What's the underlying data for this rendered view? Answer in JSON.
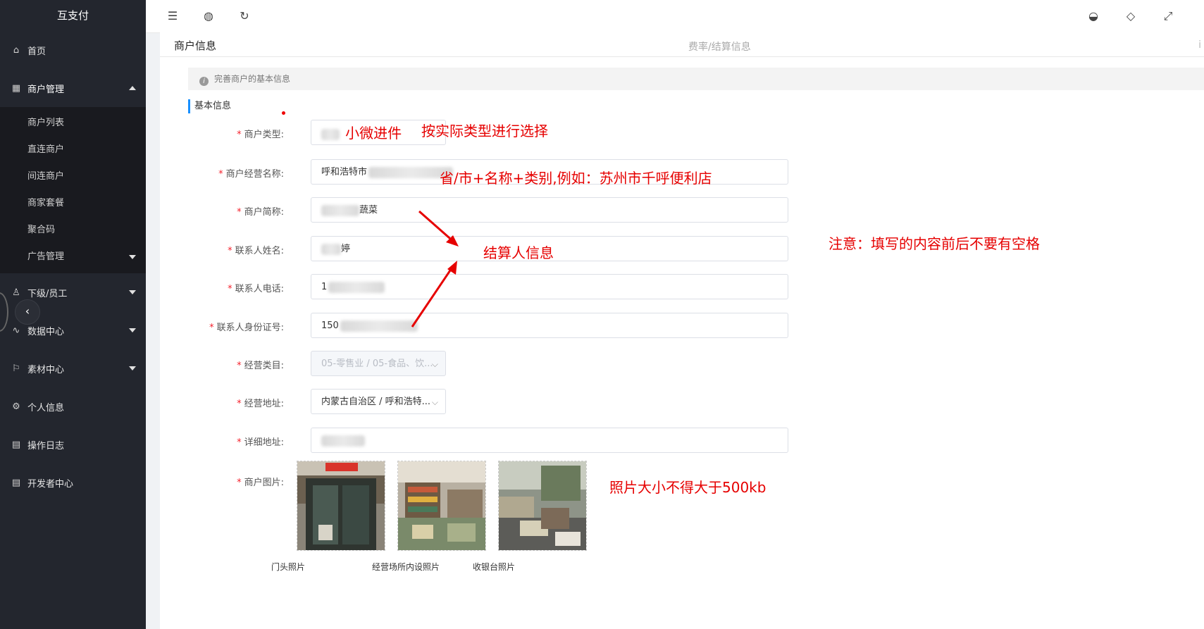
{
  "app": {
    "title": "互支付"
  },
  "sidebar": {
    "items": [
      {
        "label": "首页",
        "icon": "home-icon"
      },
      {
        "label": "商户管理",
        "icon": "grid-icon"
      },
      {
        "label": "下级/员工",
        "icon": "user-icon"
      },
      {
        "label": "数据中心",
        "icon": "pulse-icon"
      },
      {
        "label": "素材中心",
        "icon": "flag-icon"
      },
      {
        "label": "个人信息",
        "icon": "gear-icon"
      },
      {
        "label": "操作日志",
        "icon": "document-icon"
      },
      {
        "label": "开发者中心",
        "icon": "document-icon"
      }
    ],
    "submenu": [
      "商户列表",
      "直连商户",
      "间连商户",
      "商家套餐",
      "聚合码",
      "广告管理"
    ]
  },
  "panel": {
    "title": "商户信息",
    "tab_rate": "费率/结算信息",
    "tab_more": "i",
    "info": "完善商户的基本信息",
    "section": "基本信息"
  },
  "form": {
    "merchant_type": {
      "label": "商户类型:",
      "value": "小微进件"
    },
    "business_name": {
      "label": "商户经营名称:",
      "value": "呼和浩特市"
    },
    "short_name": {
      "label": "商户简称:",
      "value": "蔬菜"
    },
    "contact_name": {
      "label": "联系人姓名:",
      "value": "婷"
    },
    "contact_phone": {
      "label": "联系人电话:",
      "value": "1"
    },
    "contact_id": {
      "label": "联系人身份证号:",
      "value": "150"
    },
    "category": {
      "label": "经营类目:",
      "value": "05-零售业 / 05-食品、饮..."
    },
    "address": {
      "label": "经营地址:",
      "value": "内蒙古自治区 / 呼和浩特..."
    },
    "detail_address": {
      "label": "详细地址:",
      "value": ""
    },
    "photos": {
      "label": "商户图片:",
      "captions": [
        "门头照片",
        "经营场所内设照片",
        "收银台照片"
      ]
    }
  },
  "annotations": {
    "select_type": "按实际类型进行选择",
    "name_format": "省/市+名称+类别,例如：苏州市千呼便利店",
    "settlement": "结算人信息",
    "no_spaces": "注意：填写的内容前后不要有空格",
    "photo_size": "照片大小不得大于500kb"
  },
  "colors": {
    "sidebar_bg": "#23262e",
    "accent": "#1890ff",
    "annotation": "#e60000",
    "required": "#f5222d"
  }
}
